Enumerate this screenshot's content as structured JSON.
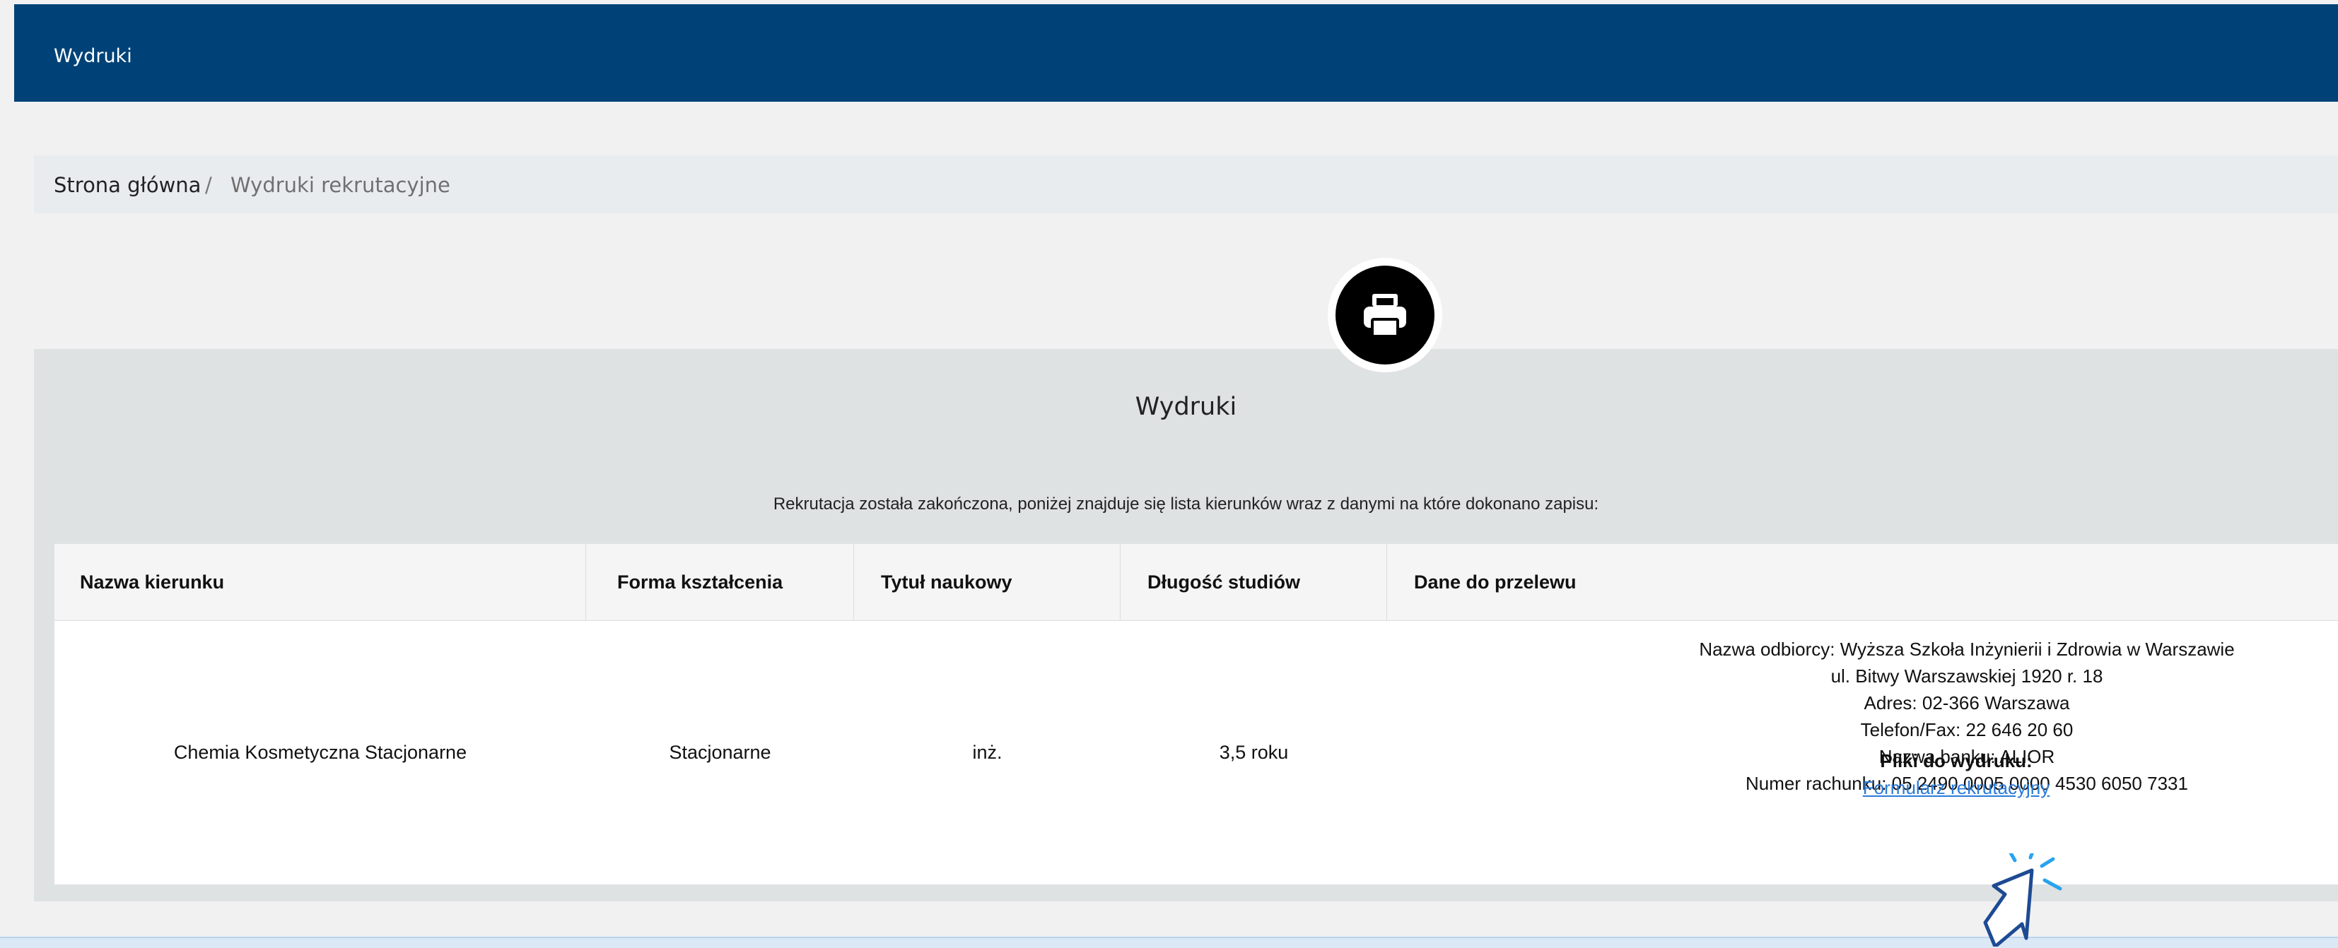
{
  "header": {
    "title": "Wydruki"
  },
  "breadcrumb": {
    "home": "Strona główna",
    "separator": "/",
    "current": "Wydruki rekrutacyjne"
  },
  "panel": {
    "title": "Wydruki",
    "info": "Rekrutacja została zakończona, poniżej znajduje się lista kierunków wraz z danymi na które dokonano zapisu:",
    "icon": "printer-icon"
  },
  "table": {
    "columns": [
      "Nazwa kierunku",
      "Forma kształcenia",
      "Tytuł naukowy",
      "Długość studiów",
      "Dane do przelewu"
    ],
    "rows": [
      {
        "name": "Chemia Kosmetyczna Stacjonarne",
        "form": "Stacjonarne",
        "title": "inż.",
        "duration": "3,5 roku",
        "transfer": [
          "Nazwa odbiorcy: Wyższa Szkoła Inżynierii i Zdrowia w Warszawie",
          "ul. Bitwy Warszawskiej 1920 r. 18",
          "Adres: 02-366 Warszawa",
          "Telefon/Fax: 22 646 20 60",
          "Nazwa banku: ALIOR",
          "Numer rachunku: 05 2490 0005 0000 4530 6050 7331"
        ],
        "files_label": "Pliki do wydruku:",
        "file_link": "Formularz rekrutacyjny"
      }
    ]
  },
  "colors": {
    "header": "#004277",
    "link": "#2a7bd9",
    "panel": "#dfe2e2"
  }
}
